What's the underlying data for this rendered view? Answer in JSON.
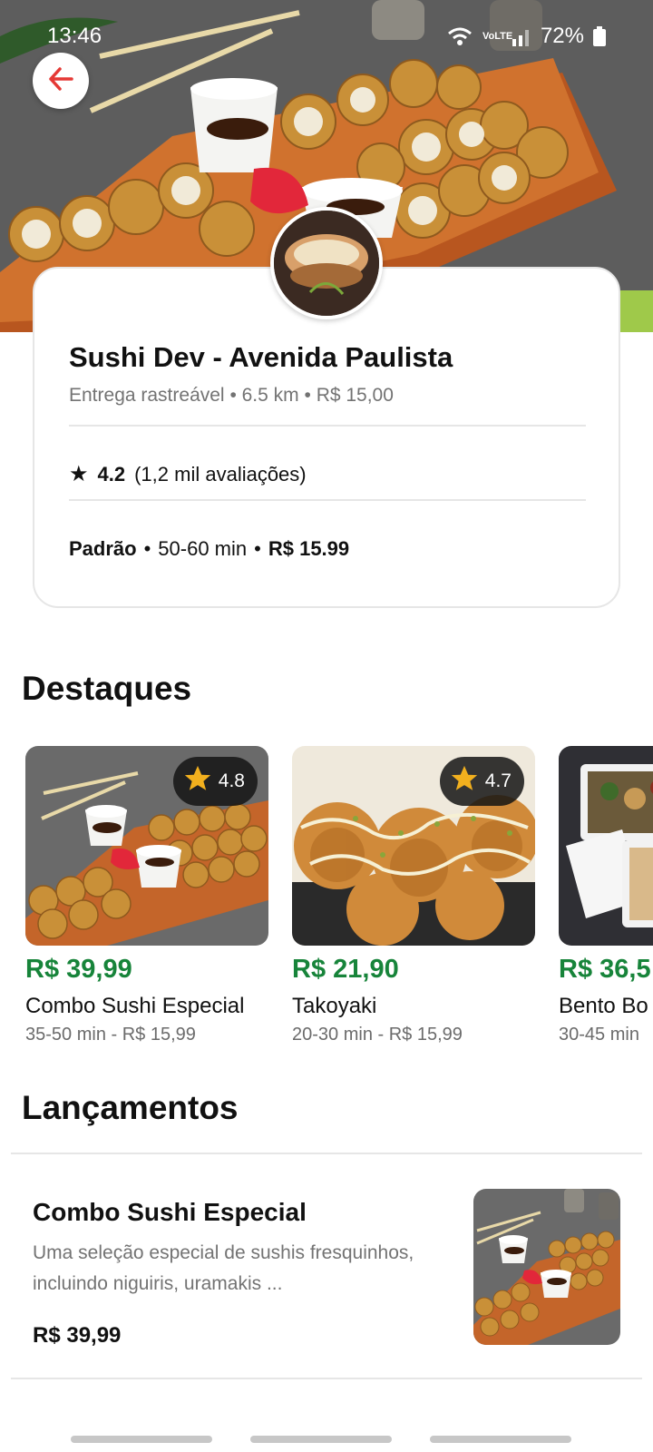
{
  "status_bar": {
    "time": "13:46",
    "battery": "72%",
    "network": "VoLTE"
  },
  "store": {
    "name": "Sushi Dev - Avenida Paulista",
    "delivery_type": "Entrega rastreável",
    "distance": "6.5 km",
    "fee": "R$ 15,00",
    "rating": "4.2",
    "reviews": "(1,2 mil avaliações)",
    "mode": "Padrão",
    "time": "50-60 min",
    "price": "R$ 15.99"
  },
  "sections": {
    "highlights": "Destaques",
    "launches": "Lançamentos"
  },
  "highlights": [
    {
      "rating": "4.8",
      "price": "R$ 39,99",
      "name": "Combo Sushi Especial",
      "meta": "35-50 min - R$ 15,99"
    },
    {
      "rating": "4.7",
      "price": "R$ 21,90",
      "name": "Takoyaki",
      "meta": "20-30 min - R$ 15,99"
    },
    {
      "rating": "",
      "price": "R$ 36,5",
      "name": "Bento Bo",
      "meta": "30-45 min"
    }
  ],
  "launches": [
    {
      "name": "Combo Sushi Especial",
      "description": "Uma seleção especial de sushis fresquinhos, incluindo niguiris, uramakis ...",
      "price": "R$ 39,99"
    }
  ],
  "icons": {
    "back": "arrow-left-icon",
    "star": "star-icon",
    "wifi": "wifi-icon",
    "signal": "signal-icon",
    "battery": "battery-icon"
  },
  "colors": {
    "price_green": "#17843a",
    "back_arrow": "#e53935",
    "badge_star": "#f2b01e"
  }
}
